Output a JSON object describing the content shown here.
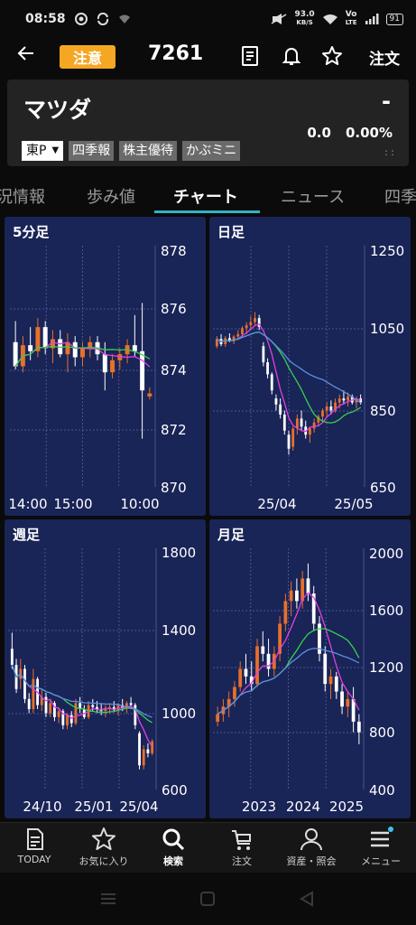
{
  "status_bar": {
    "time": "08:58",
    "net_speed": "93.0",
    "net_unit": "KB/S",
    "volte_top": "Vo",
    "volte_bottom": "LTE",
    "battery": "91"
  },
  "header": {
    "back_icon": "arrow-left-icon",
    "caution_badge": "注意",
    "code": "7261",
    "order_label": "注文",
    "icons": [
      "document-icon",
      "bell-icon",
      "star-icon"
    ]
  },
  "quote": {
    "company_name": "マツダ",
    "price": "-",
    "change": "0.0",
    "change_pct": "0.00%",
    "time_placeholder": ": :",
    "market": "東P",
    "chips": [
      "四季報",
      "株主優待",
      "かぶミニ"
    ]
  },
  "tabs": [
    "況情報",
    "歩み値",
    "チャート",
    "ニュース",
    "四季"
  ],
  "active_tab": "チャート",
  "colors": {
    "panel_bg": "#192457",
    "up_candle": "#e8702a",
    "down_candle": "#ffffff",
    "ma_short": "#e040e0",
    "ma_mid": "#3ad04a",
    "ma_long": "#5a8fe0",
    "accent": "#2fb3c9",
    "caution": "#f5a623"
  },
  "chart_data": [
    {
      "type": "candlestick",
      "title": "5分足",
      "ylim": [
        870,
        878
      ],
      "y_ticks": [
        "878",
        "876",
        "874",
        "872",
        "870"
      ],
      "x_ticks": [
        "14:00",
        "15:00",
        "10:00"
      ],
      "moving_averages": [
        "magenta",
        "green"
      ],
      "candles": [
        [
          874.8,
          875.5,
          873.9,
          874.0
        ],
        [
          874.0,
          875.0,
          873.8,
          874.7
        ],
        [
          874.7,
          875.3,
          874.2,
          874.5
        ],
        [
          874.5,
          875.6,
          874.3,
          875.3
        ],
        [
          875.3,
          875.5,
          874.4,
          874.6
        ],
        [
          874.6,
          875.2,
          874.1,
          874.9
        ],
        [
          874.9,
          875.2,
          874.3,
          874.4
        ],
        [
          874.4,
          875.1,
          873.8,
          874.8
        ],
        [
          874.8,
          875.0,
          874.0,
          874.3
        ],
        [
          874.3,
          874.8,
          874.0,
          874.6
        ],
        [
          874.6,
          875.0,
          874.3,
          874.8
        ],
        [
          874.8,
          875.0,
          874.2,
          874.4
        ],
        [
          874.4,
          874.8,
          873.2,
          873.8
        ],
        [
          873.8,
          874.4,
          873.6,
          874.2
        ],
        [
          874.2,
          874.6,
          873.9,
          874.4
        ],
        [
          874.4,
          874.9,
          874.1,
          874.7
        ],
        [
          874.7,
          875.7,
          874.3,
          874.5
        ],
        [
          874.5,
          876.1,
          871.6,
          873.2
        ],
        [
          873.0,
          873.3,
          872.9,
          873.1
        ]
      ]
    },
    {
      "type": "candlestick",
      "title": "日足",
      "ylim": [
        650,
        1250
      ],
      "y_ticks": [
        "1250",
        "1050",
        "850",
        "650"
      ],
      "x_ticks": [
        "25/04",
        "25/05"
      ],
      "moving_averages": [
        "magenta",
        "green",
        "blue"
      ],
      "candles": [
        [
          1000,
          1025,
          995,
          1018
        ],
        [
          1018,
          1030,
          1000,
          1005
        ],
        [
          1005,
          1025,
          998,
          1020
        ],
        [
          1020,
          1032,
          1010,
          1012
        ],
        [
          1012,
          1028,
          1005,
          1024
        ],
        [
          1024,
          1040,
          1015,
          1030
        ],
        [
          1030,
          1050,
          1022,
          1045
        ],
        [
          1045,
          1060,
          1030,
          1052
        ],
        [
          1052,
          1075,
          1040,
          1060
        ],
        [
          1060,
          1085,
          1050,
          1070
        ],
        [
          1070,
          1078,
          1040,
          1048
        ],
        [
          1000,
          1010,
          950,
          960
        ],
        [
          960,
          970,
          920,
          930
        ],
        [
          930,
          935,
          880,
          890
        ],
        [
          870,
          880,
          840,
          855
        ],
        [
          855,
          870,
          820,
          830
        ],
        [
          830,
          840,
          780,
          790
        ],
        [
          780,
          790,
          730,
          745
        ],
        [
          750,
          800,
          740,
          795
        ],
        [
          795,
          830,
          780,
          820
        ],
        [
          820,
          840,
          790,
          800
        ],
        [
          800,
          815,
          770,
          780
        ],
        [
          780,
          800,
          760,
          795
        ],
        [
          795,
          820,
          785,
          810
        ],
        [
          810,
          830,
          800,
          825
        ],
        [
          825,
          845,
          810,
          840
        ],
        [
          840,
          860,
          825,
          850
        ],
        [
          850,
          865,
          830,
          840
        ],
        [
          840,
          870,
          835,
          860
        ],
        [
          860,
          880,
          845,
          870
        ],
        [
          870,
          890,
          855,
          865
        ],
        [
          865,
          885,
          850,
          875
        ],
        [
          875,
          880,
          855,
          860
        ],
        [
          860,
          875,
          845,
          870
        ],
        [
          870,
          880,
          855,
          860
        ]
      ]
    },
    {
      "type": "candlestick",
      "title": "週足",
      "ylim": [
        600,
        1800
      ],
      "y_ticks": [
        "1800",
        "1400",
        "1000",
        "600"
      ],
      "x_ticks": [
        "24/10",
        "25/01",
        "25/04"
      ],
      "moving_averages": [
        "magenta",
        "green",
        "blue"
      ],
      "candles": [
        [
          1300,
          1380,
          1200,
          1220
        ],
        [
          1220,
          1250,
          1080,
          1100
        ],
        [
          1150,
          1250,
          1100,
          1200
        ],
        [
          1200,
          1220,
          1030,
          1050
        ],
        [
          1050,
          1080,
          980,
          1000
        ],
        [
          1000,
          1200,
          980,
          1150
        ],
        [
          1150,
          1160,
          1000,
          1020
        ],
        [
          1020,
          1100,
          990,
          1060
        ],
        [
          1060,
          1080,
          960,
          980
        ],
        [
          980,
          1050,
          960,
          1030
        ],
        [
          1030,
          1040,
          940,
          960
        ],
        [
          960,
          1010,
          930,
          990
        ],
        [
          990,
          1000,
          900,
          920
        ],
        [
          920,
          980,
          900,
          970
        ],
        [
          970,
          990,
          910,
          930
        ],
        [
          930,
          1050,
          920,
          1030
        ],
        [
          1030,
          1060,
          980,
          1000
        ],
        [
          1000,
          1020,
          950,
          960
        ],
        [
          960,
          1040,
          950,
          1020
        ],
        [
          1020,
          1050,
          990,
          1010
        ],
        [
          1010,
          1040,
          980,
          1000
        ],
        [
          1000,
          1030,
          970,
          990
        ],
        [
          990,
          1020,
          960,
          1000
        ],
        [
          1000,
          1030,
          980,
          1010
        ],
        [
          1010,
          1040,
          985,
          995
        ],
        [
          995,
          1030,
          970,
          1020
        ],
        [
          1020,
          1050,
          990,
          1005
        ],
        [
          1005,
          1040,
          980,
          1030
        ],
        [
          1030,
          1060,
          1000,
          1020
        ],
        [
          1020,
          1030,
          900,
          920
        ],
        [
          880,
          890,
          700,
          720
        ],
        [
          720,
          820,
          700,
          800
        ],
        [
          800,
          830,
          760,
          780
        ],
        [
          780,
          850,
          770,
          840
        ]
      ]
    },
    {
      "type": "candlestick",
      "title": "月足",
      "ylim": [
        400,
        2000
      ],
      "y_ticks": [
        "2000",
        "1600",
        "1200",
        "800",
        "400"
      ],
      "x_ticks": [
        "2023",
        "2024",
        "2025"
      ],
      "moving_averages": [
        "magenta",
        "green",
        "blue"
      ],
      "candles": [
        [
          850,
          950,
          820,
          900
        ],
        [
          900,
          1000,
          850,
          950
        ],
        [
          950,
          1050,
          880,
          1000
        ],
        [
          1000,
          1120,
          950,
          1080
        ],
        [
          1080,
          1250,
          1050,
          1200
        ],
        [
          1200,
          1300,
          1100,
          1150
        ],
        [
          1150,
          1250,
          1050,
          1100
        ],
        [
          1100,
          1400,
          1080,
          1350
        ],
        [
          1350,
          1450,
          1250,
          1300
        ],
        [
          1300,
          1400,
          1150,
          1200
        ],
        [
          1200,
          1350,
          1150,
          1300
        ],
        [
          1300,
          1550,
          1250,
          1500
        ],
        [
          1500,
          1700,
          1450,
          1650
        ],
        [
          1650,
          1780,
          1550,
          1720
        ],
        [
          1720,
          1800,
          1600,
          1650
        ],
        [
          1650,
          1850,
          1600,
          1800
        ],
        [
          1800,
          1900,
          1650,
          1700
        ],
        [
          1700,
          1750,
          1450,
          1500
        ],
        [
          1500,
          1550,
          1250,
          1300
        ],
        [
          1300,
          1350,
          1050,
          1100
        ],
        [
          1100,
          1200,
          1000,
          1150
        ],
        [
          1150,
          1180,
          1000,
          1050
        ],
        [
          1050,
          1100,
          900,
          950
        ],
        [
          950,
          1050,
          880,
          1000
        ],
        [
          1000,
          1080,
          780,
          850
        ],
        [
          850,
          900,
          700,
          780
        ]
      ]
    }
  ],
  "bottom_nav": [
    {
      "label": "TODAY",
      "icon": "news-icon"
    },
    {
      "label": "お気に入り",
      "icon": "star-icon"
    },
    {
      "label": "検索",
      "icon": "search-icon"
    },
    {
      "label": "注文",
      "icon": "cart-icon"
    },
    {
      "label": "資産・照会",
      "icon": "person-icon"
    },
    {
      "label": "メニュー",
      "icon": "menu-icon"
    }
  ],
  "active_nav": "検索"
}
